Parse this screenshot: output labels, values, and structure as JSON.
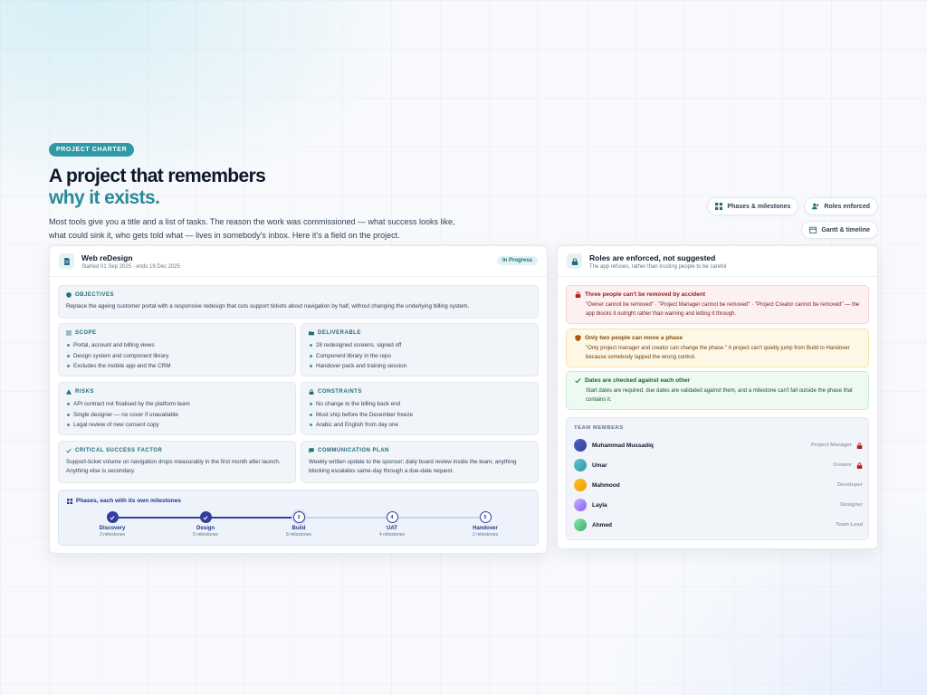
{
  "hero": {
    "badge": "PROJECT CHARTER",
    "title_line1": "A project that remembers",
    "title_line2": "why it exists.",
    "description": "Most tools give you a title and a list of tasks. The reason the work was commissioned — what success looks like, what could sink it, who gets told what — lives in somebody's inbox. Here it's a field on the project."
  },
  "chips": [
    {
      "label": "Phases & milestones",
      "icon": "grid-icon"
    },
    {
      "label": "Roles enforced",
      "icon": "users-icon"
    },
    {
      "label": "Gantt & timeline",
      "icon": "calendar-icon"
    }
  ],
  "project": {
    "name": "Web reDesign",
    "dates": "Started 01 Sep 2025 · ends 19 Dec 2025",
    "status": "In Progress",
    "objectives": {
      "title": "OBJECTIVES",
      "text": "Replace the ageing customer portal with a responsive redesign that cuts support tickets about navigation by half, without changing the underlying billing system."
    },
    "scope": {
      "title": "SCOPE",
      "items": [
        "Portal, account and billing views",
        "Design system and component library",
        "Excludes the mobile app and the CRM"
      ]
    },
    "deliverable": {
      "title": "DELIVERABLE",
      "items": [
        "28 redesigned screens, signed off",
        "Component library in the repo",
        "Handover pack and training session"
      ]
    },
    "risks": {
      "title": "RISKS",
      "items": [
        "API contract not finalised by the platform team",
        "Single designer — no cover if unavailable",
        "Legal review of new consent copy"
      ]
    },
    "constraints": {
      "title": "CONSTRAINTS",
      "items": [
        "No change to the billing back end",
        "Must ship before the December freeze",
        "Arabic and English from day one"
      ]
    },
    "csf": {
      "title": "CRITICAL SUCCESS FACTOR",
      "text": "Support-ticket volume on navigation drops measurably in the first month after launch. Anything else is secondary."
    },
    "comms": {
      "title": "COMMUNICATION PLAN",
      "text": "Weekly written update to the sponsor; daily board review inside the team; anything blocking escalates same-day through a due-date request."
    },
    "phases_title": "Phases, each with its own milestones",
    "phases": [
      {
        "name": "Discovery",
        "milestones": "3 milestones",
        "state": "done",
        "number": "1"
      },
      {
        "name": "Design",
        "milestones": "5 milestones",
        "state": "done",
        "number": "2"
      },
      {
        "name": "Build",
        "milestones": "8 milestones",
        "state": "current",
        "number": "3"
      },
      {
        "name": "UAT",
        "milestones": "4 milestones",
        "state": "todo",
        "number": "4"
      },
      {
        "name": "Handover",
        "milestones": "2 milestones",
        "state": "todo",
        "number": "5"
      }
    ]
  },
  "roles": {
    "title": "Roles are enforced, not suggested",
    "subtitle": "The app refuses, rather than trusting people to be careful",
    "rules": [
      {
        "tone": "red",
        "icon": "lock-icon",
        "title": "Three people can't be removed by accident",
        "text": "\"Owner cannot be removed\" · \"Project Manager cannot be removed\" · \"Project Creator cannot be removed\" — the app blocks it outright rather than warning and letting it through."
      },
      {
        "tone": "amber",
        "icon": "shield-icon",
        "title": "Only two people can move a phase",
        "text": "\"Only project manager and creator can change the phase.\" A project can't quietly jump from Build to Handover because somebody tapped the wrong control."
      },
      {
        "tone": "green",
        "icon": "check-icon",
        "title": "Dates are checked against each other",
        "text": "Start dates are required, due dates are validated against them, and a milestone can't fall outside the phase that contains it."
      }
    ],
    "team_title": "TEAM MEMBERS",
    "members": [
      {
        "name": "Muhammad Mussadiq",
        "role": "Project Manager",
        "locked": true,
        "color": "#3f4fb3"
      },
      {
        "name": "Umar",
        "role": "Creator",
        "locked": true,
        "color": "#3ea4b3"
      },
      {
        "name": "Mahmood",
        "role": "Developer",
        "locked": false,
        "color": "#f5a524"
      },
      {
        "name": "Layla",
        "role": "Designer",
        "locked": false,
        "color": "#a78bfa"
      },
      {
        "name": "Ahmed",
        "role": "Team Lead",
        "locked": false,
        "color": "#5cc089"
      }
    ]
  }
}
